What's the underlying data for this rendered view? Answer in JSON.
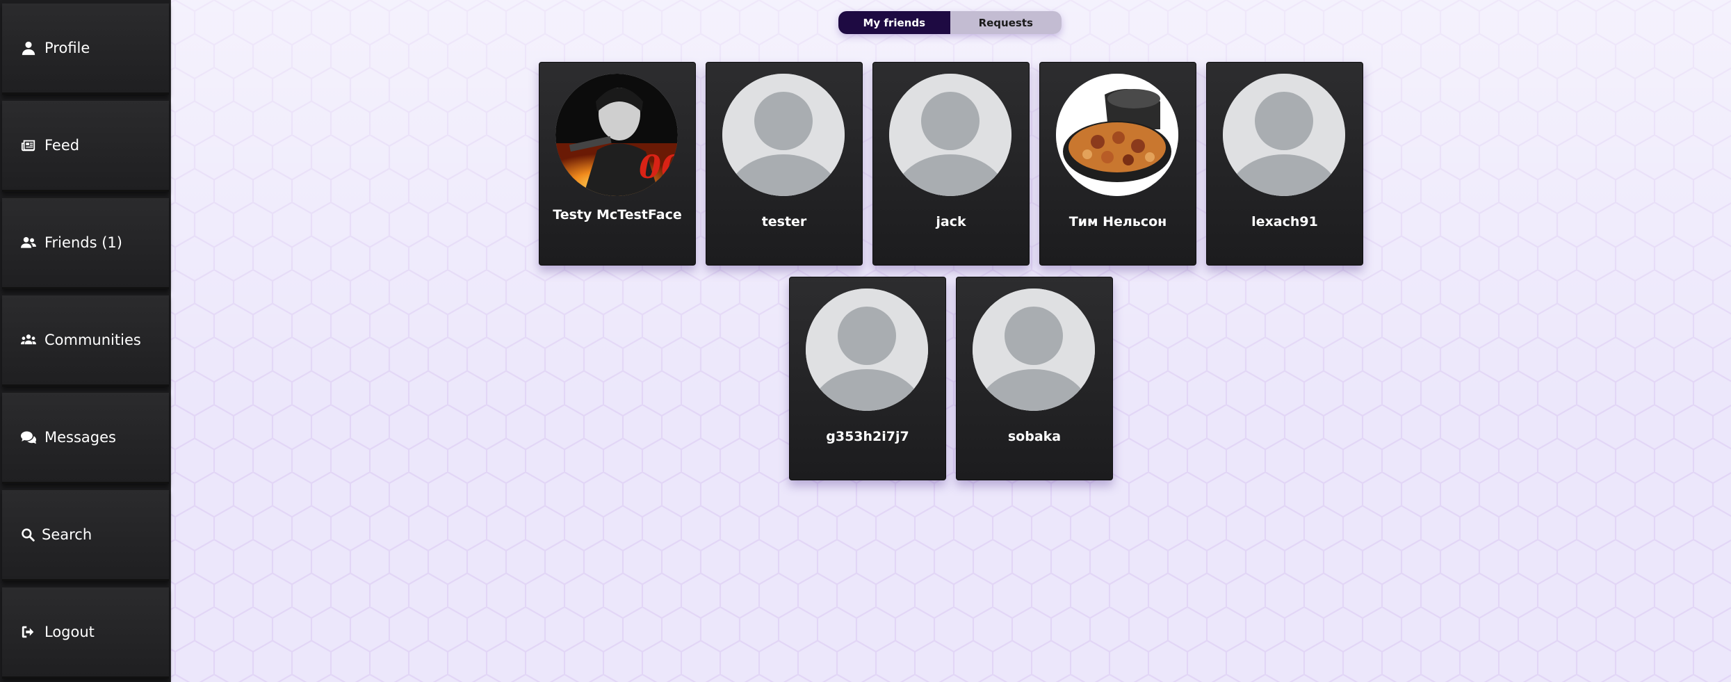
{
  "sidebar": {
    "items": [
      {
        "label": "Profile",
        "icon": "user-icon"
      },
      {
        "label": "Feed",
        "icon": "newspaper-icon"
      },
      {
        "label": "Friends (1)",
        "icon": "user-friends-icon"
      },
      {
        "label": "Communities",
        "icon": "users-icon"
      },
      {
        "label": "Messages",
        "icon": "comments-icon"
      },
      {
        "label": "Search",
        "icon": "search-icon"
      },
      {
        "label": "Logout",
        "icon": "logout-icon"
      }
    ]
  },
  "tabs": {
    "my_friends": "My friends",
    "requests": "Requests"
  },
  "friends": [
    {
      "name": "Testy McTestFace",
      "avatar": "photo-007-avatar"
    },
    {
      "name": "tester",
      "avatar": "default-avatar"
    },
    {
      "name": "jack",
      "avatar": "default-avatar"
    },
    {
      "name": "Тим Нельсон",
      "avatar": "photo-pizza-oven-avatar"
    },
    {
      "name": "lexach91",
      "avatar": "default-avatar"
    },
    {
      "name": "g353h2i7j7",
      "avatar": "default-avatar"
    },
    {
      "name": "sobaka",
      "avatar": "default-avatar"
    }
  ]
}
